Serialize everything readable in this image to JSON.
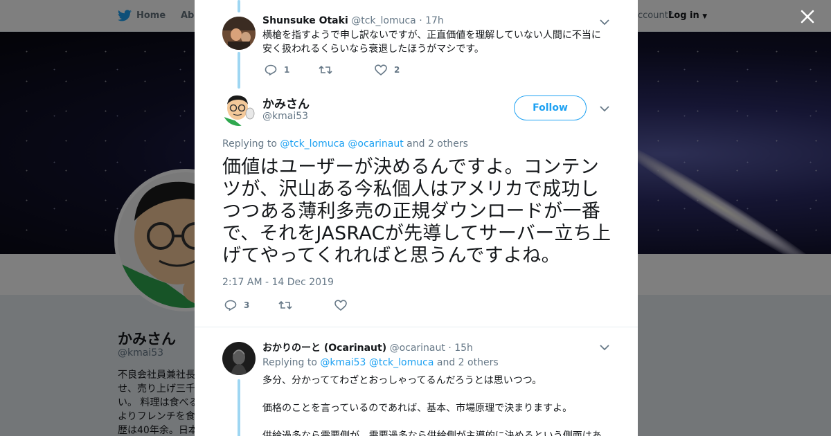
{
  "topbar": {
    "home_label": "Home",
    "about_label": "Abo",
    "account_prompt": "ccount?",
    "login_label": "Log in"
  },
  "profile": {
    "name": "かみさん",
    "handle": "@kmai53",
    "bio_lines": [
      "不良会社員兼社長",
      "せ、売り上げ三千",
      "い。 料理は食べる",
      "よりフレンチを食",
      "歴は40年余。日本"
    ]
  },
  "thread": {
    "prev_tweet": {
      "name": "Shunsuke Otaki",
      "handle": "@tck_lomuca",
      "time": "· 17h",
      "text_line1": "横槍を指すようで申し訳ないですが、正直価値を理解していない人間に不当に",
      "text_line2": "安く扱われるくらいなら衰退したほうがマシです。",
      "reply_count": "1",
      "like_count": "2"
    },
    "main_tweet": {
      "name": "かみさん",
      "handle": "@kmai53",
      "follow_label": "Follow",
      "replying_prefix": "Replying to",
      "replying_user1": "@tck_lomuca",
      "replying_user2": "@ocarinaut",
      "replying_suffix": "and 2 others",
      "text": "価値はユーザーが決めるんですよ。コンテンツが、沢山ある今私個人はアメリカで成功しつつある薄利多売の正規ダウンロードが一番で、それをJASRACが先導してサーバー立ち上げてやってくれればと思うんですよね。",
      "timestamp": "2:17 AM - 14 Dec 2019",
      "reply_count": "3"
    },
    "reply_tweet": {
      "name": "おかりのーと (Ocarinaut)",
      "handle": "@ocarinaut",
      "time": "· 15h",
      "replying_prefix": "Replying to",
      "replying_user1": "@kmai53",
      "replying_user2": "@tck_lomuca",
      "replying_suffix": "and 2 others",
      "para1": "多分、分かっててわざとおっしゃってるんだろうとは思いつつ。",
      "para2": "価格のことを言っているのであれば、基本、市場原理で決まりますよ。",
      "para3": "供給過多なら需要側が、需要過多なら供給側が主導的に決めるという側面はあ"
    }
  },
  "colors": {
    "accent": "#1da1f2",
    "thread_line": "#9ed6f2",
    "muted": "#657786"
  },
  "icons": [
    "twitter-bird-icon",
    "close-icon",
    "chevron-down-icon",
    "reply-icon",
    "retweet-icon",
    "like-icon"
  ]
}
